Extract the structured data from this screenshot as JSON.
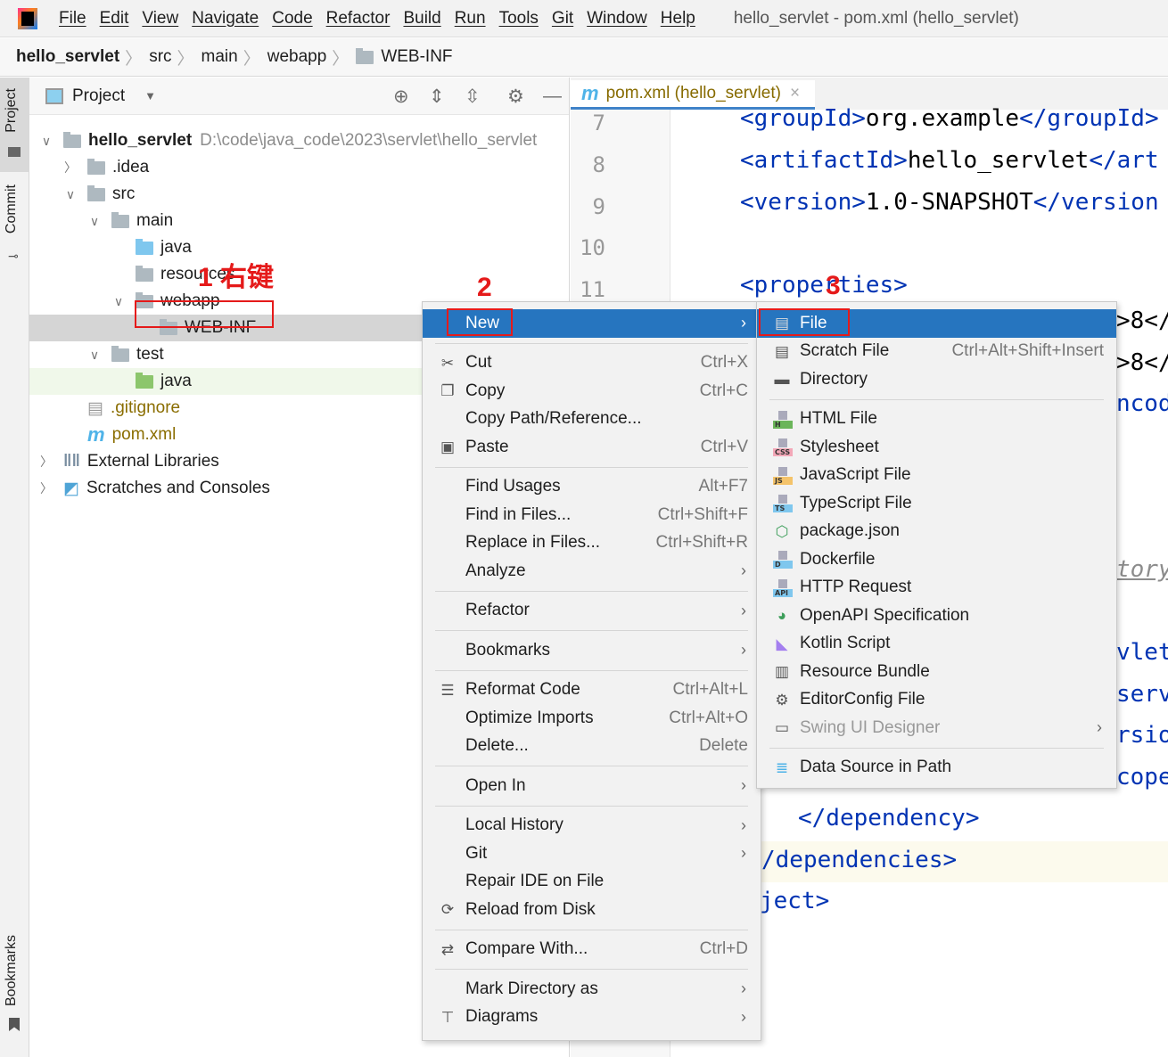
{
  "menubar": {
    "items": [
      "File",
      "Edit",
      "View",
      "Navigate",
      "Code",
      "Refactor",
      "Build",
      "Run",
      "Tools",
      "Git",
      "Window",
      "Help"
    ],
    "window_title": "hello_servlet - pom.xml (hello_servlet)"
  },
  "breadcrumb": [
    "hello_servlet",
    "src",
    "main",
    "webapp",
    "WEB-INF"
  ],
  "stripe": {
    "project": "Project",
    "commit": "Commit",
    "bookmarks": "Bookmarks"
  },
  "project_panel": {
    "title": "Project",
    "tree": [
      {
        "depth": 0,
        "chev": "open",
        "icon": "module-folder",
        "label": "hello_servlet",
        "bold": true,
        "path": "D:\\code\\java_code\\2023\\servlet\\hello_servlet"
      },
      {
        "depth": 1,
        "chev": "closed",
        "icon": "folder",
        "label": ".idea"
      },
      {
        "depth": 1,
        "chev": "open",
        "icon": "folder",
        "label": "src"
      },
      {
        "depth": 2,
        "chev": "open",
        "icon": "folder",
        "label": "main"
      },
      {
        "depth": 3,
        "chev": "",
        "icon": "folder-blue",
        "label": "java"
      },
      {
        "depth": 3,
        "chev": "",
        "icon": "folder-resources",
        "label": "resources"
      },
      {
        "depth": 3,
        "chev": "open",
        "icon": "folder",
        "label": "webapp"
      },
      {
        "depth": 4,
        "chev": "",
        "icon": "folder",
        "label": "WEB-INF",
        "selected": true
      },
      {
        "depth": 2,
        "chev": "open",
        "icon": "folder",
        "label": "test"
      },
      {
        "depth": 3,
        "chev": "",
        "icon": "folder-green",
        "label": "java",
        "highlight": true
      },
      {
        "depth": 1,
        "chev": "",
        "icon": "gitignore-file",
        "label": ".gitignore",
        "color": "#8a6d00"
      },
      {
        "depth": 1,
        "chev": "",
        "icon": "maven-file",
        "label": "pom.xml",
        "color": "#8a6d00"
      },
      {
        "depth": 0,
        "chev": "closed",
        "icon": "libraries",
        "label": "External Libraries"
      },
      {
        "depth": 0,
        "chev": "closed",
        "icon": "scratches",
        "label": "Scratches and Consoles"
      }
    ]
  },
  "editor": {
    "tab_label": "pom.xml (hello_servlet)",
    "lines": [
      {
        "n": "7",
        "parts": [
          [
            "t",
            "<groupId>"
          ],
          [
            "x",
            "org.example"
          ],
          [
            "t",
            "</groupId>"
          ]
        ]
      },
      {
        "n": "8",
        "parts": [
          [
            "t",
            "<artifactId>"
          ],
          [
            "x",
            "hello_servlet"
          ],
          [
            "t",
            "</art"
          ]
        ]
      },
      {
        "n": "9",
        "parts": [
          [
            "t",
            "<version>"
          ],
          [
            "x",
            "1.0-SNAPSHOT"
          ],
          [
            "t",
            "</version"
          ]
        ]
      },
      {
        "n": "10",
        "parts": []
      },
      {
        "n": "11",
        "parts": [
          [
            "t",
            "<properties>"
          ]
        ]
      }
    ],
    "fragments": [
      ">8</",
      ">8</",
      "ncod",
      "tory",
      "vlet",
      "serv",
      "rsio",
      "cope"
    ],
    "lower_lines": [
      "</dependency>",
      "/dependencies>",
      "ject>"
    ]
  },
  "context_menu": [
    {
      "label": "New",
      "submenu": true,
      "selected": true
    },
    {
      "sep": true
    },
    {
      "label": "Cut",
      "shortcut": "Ctrl+X",
      "icon": "scissors-icon"
    },
    {
      "label": "Copy",
      "shortcut": "Ctrl+C",
      "icon": "copy-icon"
    },
    {
      "label": "Copy Path/Reference..."
    },
    {
      "label": "Paste",
      "shortcut": "Ctrl+V",
      "icon": "paste-icon"
    },
    {
      "sep": true
    },
    {
      "label": "Find Usages",
      "shortcut": "Alt+F7"
    },
    {
      "label": "Find in Files...",
      "shortcut": "Ctrl+Shift+F"
    },
    {
      "label": "Replace in Files...",
      "shortcut": "Ctrl+Shift+R"
    },
    {
      "label": "Analyze",
      "submenu": true
    },
    {
      "sep": true
    },
    {
      "label": "Refactor",
      "submenu": true
    },
    {
      "sep": true
    },
    {
      "label": "Bookmarks",
      "submenu": true
    },
    {
      "sep": true
    },
    {
      "label": "Reformat Code",
      "shortcut": "Ctrl+Alt+L",
      "icon": "reformat-icon"
    },
    {
      "label": "Optimize Imports",
      "shortcut": "Ctrl+Alt+O"
    },
    {
      "label": "Delete...",
      "shortcut": "Delete"
    },
    {
      "sep": true
    },
    {
      "label": "Open In",
      "submenu": true
    },
    {
      "sep": true
    },
    {
      "label": "Local History",
      "submenu": true
    },
    {
      "label": "Git",
      "submenu": true
    },
    {
      "label": "Repair IDE on File"
    },
    {
      "label": "Reload from Disk",
      "icon": "reload-icon"
    },
    {
      "sep": true
    },
    {
      "label": "Compare With...",
      "shortcut": "Ctrl+D",
      "icon": "compare-icon"
    },
    {
      "sep": true
    },
    {
      "label": "Mark Directory as",
      "submenu": true
    },
    {
      "label": "Diagrams",
      "submenu": true,
      "icon": "diagram-icon"
    }
  ],
  "new_submenu": [
    {
      "label": "File",
      "icon": "file-icon",
      "selected": true
    },
    {
      "label": "Scratch File",
      "shortcut": "Ctrl+Alt+Shift+Insert",
      "icon": "scratch-file-icon"
    },
    {
      "label": "Directory",
      "icon": "folder-icon"
    },
    {
      "sep": true
    },
    {
      "label": "HTML File",
      "icon": "html-file-icon",
      "badge": "H",
      "badge_color": "#6bb55a"
    },
    {
      "label": "Stylesheet",
      "icon": "css-file-icon",
      "badge": "CSS",
      "badge_color": "#f3a8b8"
    },
    {
      "label": "JavaScript File",
      "icon": "js-file-icon",
      "badge": "JS",
      "badge_color": "#f4c36a"
    },
    {
      "label": "TypeScript File",
      "icon": "ts-file-icon",
      "badge": "TS",
      "badge_color": "#7fc7ee"
    },
    {
      "label": "package.json",
      "icon": "nodejs-icon"
    },
    {
      "label": "Dockerfile",
      "icon": "docker-file-icon",
      "badge": "D",
      "badge_color": "#7fc7ee"
    },
    {
      "label": "HTTP Request",
      "icon": "http-request-icon",
      "badge": "API",
      "badge_color": "#7fc7ee"
    },
    {
      "label": "OpenAPI Specification",
      "icon": "openapi-icon"
    },
    {
      "label": "Kotlin Script",
      "icon": "kotlin-icon"
    },
    {
      "label": "Resource Bundle",
      "icon": "resource-bundle-icon"
    },
    {
      "label": "EditorConfig File",
      "icon": "gear-icon"
    },
    {
      "label": "Swing UI Designer",
      "icon": "swing-icon",
      "submenu": true,
      "disabled": true
    },
    {
      "sep": true
    },
    {
      "label": "Data Source in Path",
      "icon": "database-icon"
    }
  ],
  "annotations": {
    "step1": "1 右键",
    "step2": "2",
    "step3": "3"
  },
  "colors": {
    "selection": "#2675bf",
    "annotation": "#e51a1a",
    "xml_tag": "#0033b3"
  }
}
